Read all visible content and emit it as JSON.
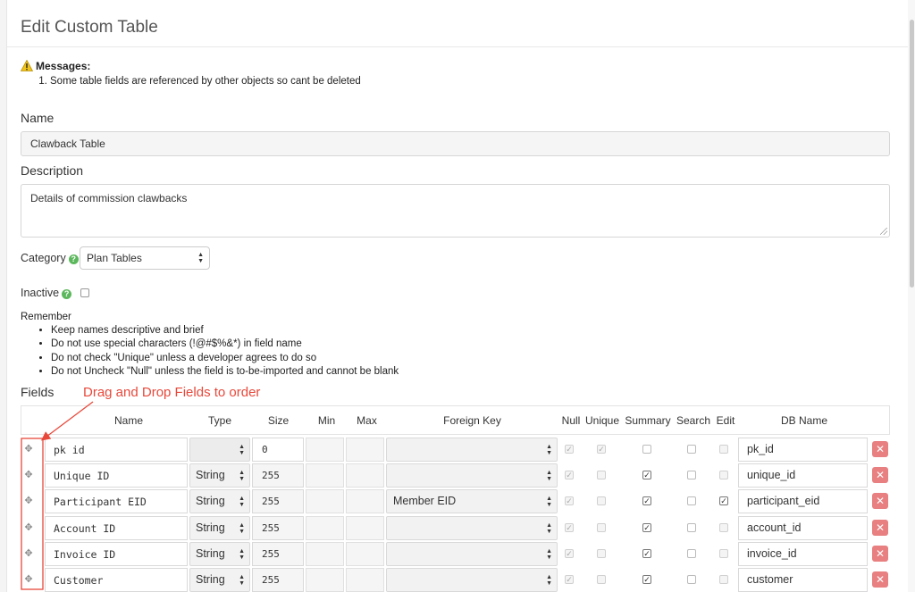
{
  "page": {
    "title": "Edit Custom Table"
  },
  "messages": {
    "heading": "Messages:",
    "items": [
      "Some table fields are referenced by other objects so cant be deleted"
    ]
  },
  "form": {
    "name_label": "Name",
    "name_value": "Clawback Table",
    "description_label": "Description",
    "description_value": "Details of commission clawbacks",
    "category_label": "Category",
    "category_value": "Plan Tables",
    "inactive_label": "Inactive"
  },
  "remember": {
    "heading": "Remember",
    "items": [
      "Keep names descriptive and brief",
      "Do not use special characters (!@#$%&*) in field name",
      "Do not check \"Unique\" unless a developer agrees to do so",
      "Do not Uncheck \"Null\" unless the field is to-be-imported and cannot be blank"
    ]
  },
  "fields": {
    "label": "Fields",
    "annotation": "Drag and Drop Fields to order",
    "columns": [
      "Name",
      "Type",
      "Size",
      "Min",
      "Max",
      "Foreign Key",
      "Null",
      "Unique",
      "Summary",
      "Search",
      "Edit",
      "DB Name"
    ],
    "rows": [
      {
        "name": "pk id",
        "type": "",
        "size": "0",
        "foreign_key": "",
        "null": true,
        "unique": true,
        "summary": false,
        "search": false,
        "edit": false,
        "db_name": "pk_id",
        "summary_disabled": false
      },
      {
        "name": "Unique ID",
        "type": "String",
        "size": "255",
        "foreign_key": "",
        "null": true,
        "unique": false,
        "summary": true,
        "search": false,
        "edit": false,
        "db_name": "unique_id"
      },
      {
        "name": "Participant EID",
        "type": "String",
        "size": "255",
        "foreign_key": "Member EID",
        "null": true,
        "unique": false,
        "summary": true,
        "search": false,
        "edit": true,
        "db_name": "participant_eid"
      },
      {
        "name": "Account ID",
        "type": "String",
        "size": "255",
        "foreign_key": "",
        "null": true,
        "unique": false,
        "summary": true,
        "search": false,
        "edit": false,
        "db_name": "account_id"
      },
      {
        "name": "Invoice ID",
        "type": "String",
        "size": "255",
        "foreign_key": "",
        "null": true,
        "unique": false,
        "summary": true,
        "search": false,
        "edit": false,
        "db_name": "invoice_id"
      },
      {
        "name": "Customer",
        "type": "String",
        "size": "255",
        "foreign_key": "",
        "null": true,
        "unique": false,
        "summary": true,
        "search": false,
        "edit": false,
        "db_name": "customer"
      }
    ]
  },
  "colors": {
    "annotation": "#e8483a",
    "delete": "#e87f80",
    "help": "#5cb85c"
  }
}
